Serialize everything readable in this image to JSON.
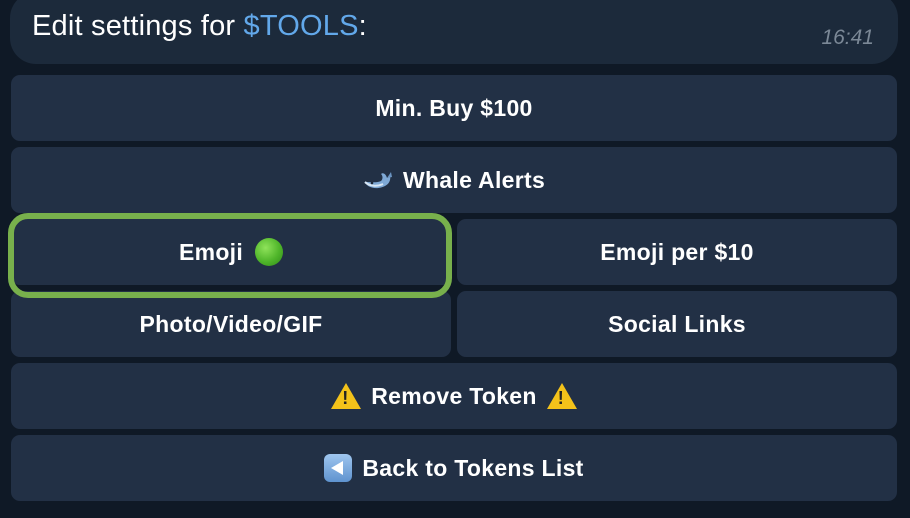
{
  "message": {
    "prefix": "Edit settings for ",
    "token": "$TOOLS",
    "suffix": ":",
    "time": "16:41"
  },
  "buttons": {
    "min_buy": "Min. Buy $100",
    "whale_alerts": "Whale Alerts",
    "emoji": "Emoji",
    "emoji_per": "Emoji per $10",
    "media": "Photo/Video/GIF",
    "social_links": "Social Links",
    "remove_token": "Remove Token",
    "back": "Back to Tokens List"
  },
  "icons": {
    "whale": "whale-icon",
    "emoji": "green-circle-icon",
    "warning": "warning-icon",
    "back": "back-arrow-icon"
  },
  "colors": {
    "background": "#0f1926",
    "button": "#223045",
    "link": "#62a8ea",
    "highlight": "#78b04c"
  }
}
